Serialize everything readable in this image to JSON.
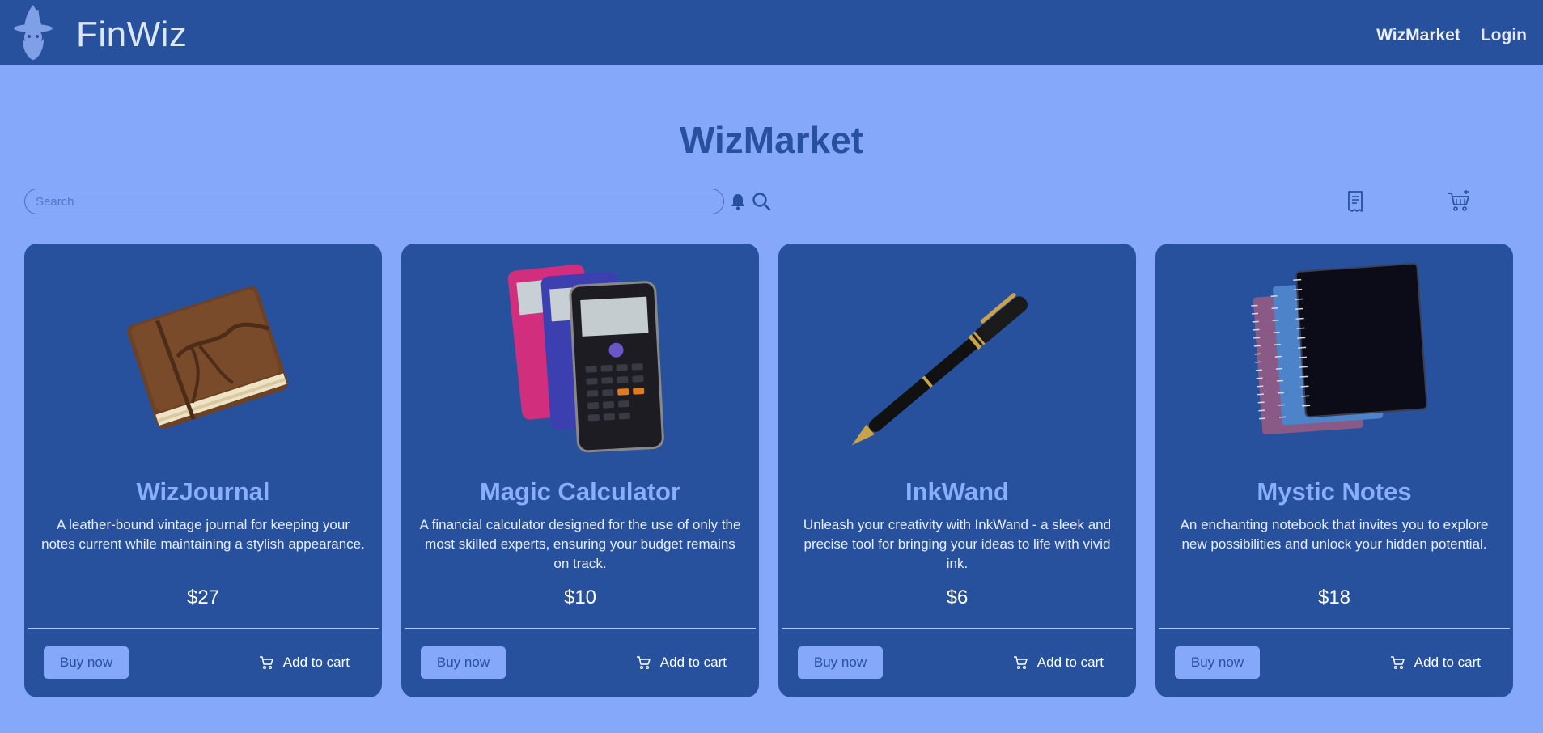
{
  "navbar": {
    "brand": "FinWiz",
    "links": [
      {
        "label": "WizMarket"
      },
      {
        "label": "Login"
      }
    ]
  },
  "page": {
    "title": "WizMarket"
  },
  "search": {
    "placeholder": "Search",
    "value": ""
  },
  "icons": {
    "logo": "wizard-logo",
    "bell": "bell-icon",
    "search": "search-icon",
    "receipt": "receipt-icon",
    "cart": "shopping-cart-icon"
  },
  "colors": {
    "background": "#85a8fb",
    "navbar": "#27519d",
    "card": "#27519d",
    "card_title": "#89aefc",
    "button": "#85a8fb"
  },
  "products": [
    {
      "name": "WizJournal",
      "description": "A leather-bound vintage journal for keeping your notes current while maintaining a stylish appearance.",
      "price": "$27",
      "buy_label": "Buy now",
      "cart_label": "Add to cart",
      "image": "leather-journal"
    },
    {
      "name": "Magic Calculator",
      "description": "A financial calculator designed for the use of only the most skilled experts, ensuring your budget remains on track.",
      "price": "$10",
      "buy_label": "Buy now",
      "cart_label": "Add to cart",
      "image": "calculators"
    },
    {
      "name": "InkWand",
      "description": "Unleash your creativity with InkWand - a sleek and precise tool for bringing your ideas to life with vivid ink.",
      "price": "$6",
      "buy_label": "Buy now",
      "cart_label": "Add to cart",
      "image": "fountain-pen"
    },
    {
      "name": "Mystic Notes",
      "description": "An enchanting notebook that invites you to explore new possibilities and unlock your hidden potential.",
      "price": "$18",
      "buy_label": "Buy now",
      "cart_label": "Add to cart",
      "image": "spiral-notebooks"
    }
  ]
}
